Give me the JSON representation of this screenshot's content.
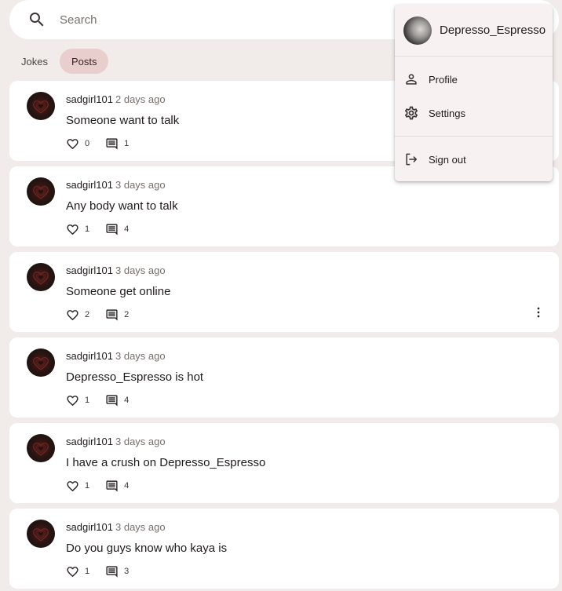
{
  "search": {
    "placeholder": "Search",
    "icon": "search-icon"
  },
  "tabs": [
    {
      "label": "Jokes",
      "active": false
    },
    {
      "label": "Posts",
      "active": true
    }
  ],
  "posts": [
    {
      "username": "sadgirl101",
      "time": "2 days ago",
      "text": "Someone want to talk",
      "likes": "0",
      "comments": "1"
    },
    {
      "username": "sadgirl101",
      "time": "3 days ago",
      "text": "Any body want to talk",
      "likes": "1",
      "comments": "4"
    },
    {
      "username": "sadgirl101",
      "time": "3 days ago",
      "text": "Someone get online",
      "likes": "2",
      "comments": "2"
    },
    {
      "username": "sadgirl101",
      "time": "3 days ago",
      "text": "Depresso_Espresso is hot",
      "likes": "1",
      "comments": "4"
    },
    {
      "username": "sadgirl101",
      "time": "3 days ago",
      "text": "I have a crush on Depresso_Espresso",
      "likes": "1",
      "comments": "4"
    },
    {
      "username": "sadgirl101",
      "time": "3 days ago",
      "text": "Do you guys know who kaya is",
      "likes": "1",
      "comments": "3"
    }
  ],
  "menu": {
    "username": "Depresso_Espresso",
    "items": [
      {
        "label": "Profile",
        "icon": "person-icon"
      },
      {
        "label": "Settings",
        "icon": "gear-icon"
      },
      {
        "label": "Sign out",
        "icon": "logout-icon"
      }
    ]
  },
  "colors": {
    "background": "#f1ecea",
    "card": "#ffffff",
    "active_tab": "#e8cfcd",
    "menu_bg": "#f7f2f1"
  }
}
